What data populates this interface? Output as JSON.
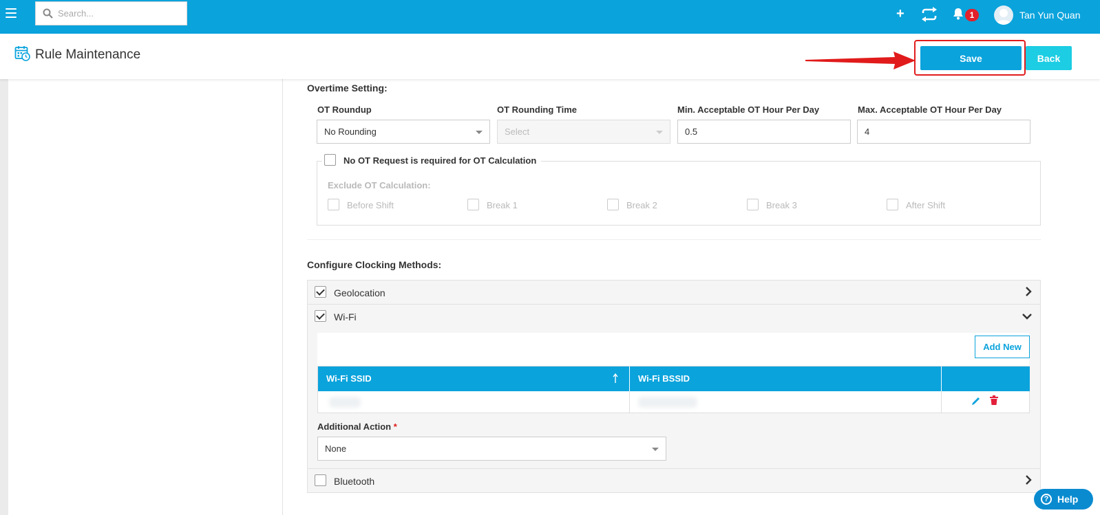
{
  "topbar": {
    "search_placeholder": "Search...",
    "notification_count": "1",
    "user_name": "Tan Yun Quan"
  },
  "header": {
    "title": "Rule Maintenance",
    "save_label": "Save",
    "back_label": "Back"
  },
  "overtime": {
    "title": "Overtime Setting:",
    "ot_roundup_label": "OT Roundup",
    "ot_roundup_value": "No Rounding",
    "ot_rounding_time_label": "OT Rounding Time",
    "ot_rounding_time_placeholder": "Select",
    "min_ot_label": "Min. Acceptable OT Hour Per Day",
    "min_ot_value": "0.5",
    "max_ot_label": "Max. Acceptable OT Hour Per Day",
    "max_ot_value": "4",
    "no_ot_request_label": "No OT Request is required for OT Calculation",
    "exclude_label": "Exclude OT Calculation:",
    "exclude_options": [
      "Before Shift",
      "Break 1",
      "Break 2",
      "Break 3",
      "After Shift"
    ]
  },
  "clocking": {
    "title": "Configure Clocking Methods:",
    "geolocation_label": "Geolocation",
    "wifi_label": "Wi-Fi",
    "bluetooth_label": "Bluetooth",
    "add_new_label": "Add New",
    "table_columns": [
      "Wi-Fi SSID",
      "Wi-Fi BSSID"
    ],
    "additional_action_label": "Additional Action",
    "additional_action_required": "*",
    "additional_action_value": "None"
  },
  "help": {
    "label": "Help"
  }
}
